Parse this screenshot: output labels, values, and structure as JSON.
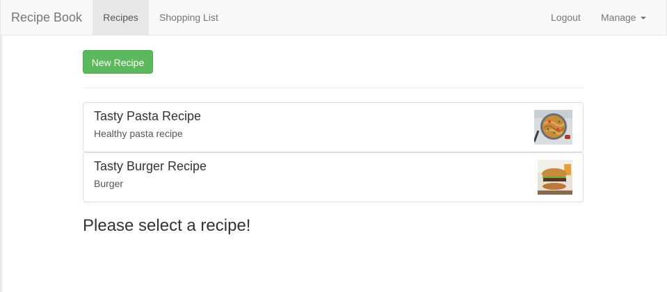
{
  "navbar": {
    "brand": "Recipe Book",
    "links": {
      "recipes": "Recipes",
      "shopping_list": "Shopping List",
      "logout": "Logout",
      "manage": "Manage"
    }
  },
  "main": {
    "new_recipe_label": "New Recipe",
    "recipes": [
      {
        "name": "Tasty Pasta Recipe",
        "description": "Healthy pasta recipe",
        "image_icon": "pasta-image"
      },
      {
        "name": "Tasty Burger Recipe",
        "description": "Burger",
        "image_icon": "burger-image"
      }
    ],
    "select_message": "Please select a recipe!"
  },
  "colors": {
    "navbar_bg": "#f8f8f8",
    "active_nav_bg": "#e7e7e7",
    "success_button": "#5cb85c",
    "text": "#333333",
    "muted_text": "#777777"
  }
}
